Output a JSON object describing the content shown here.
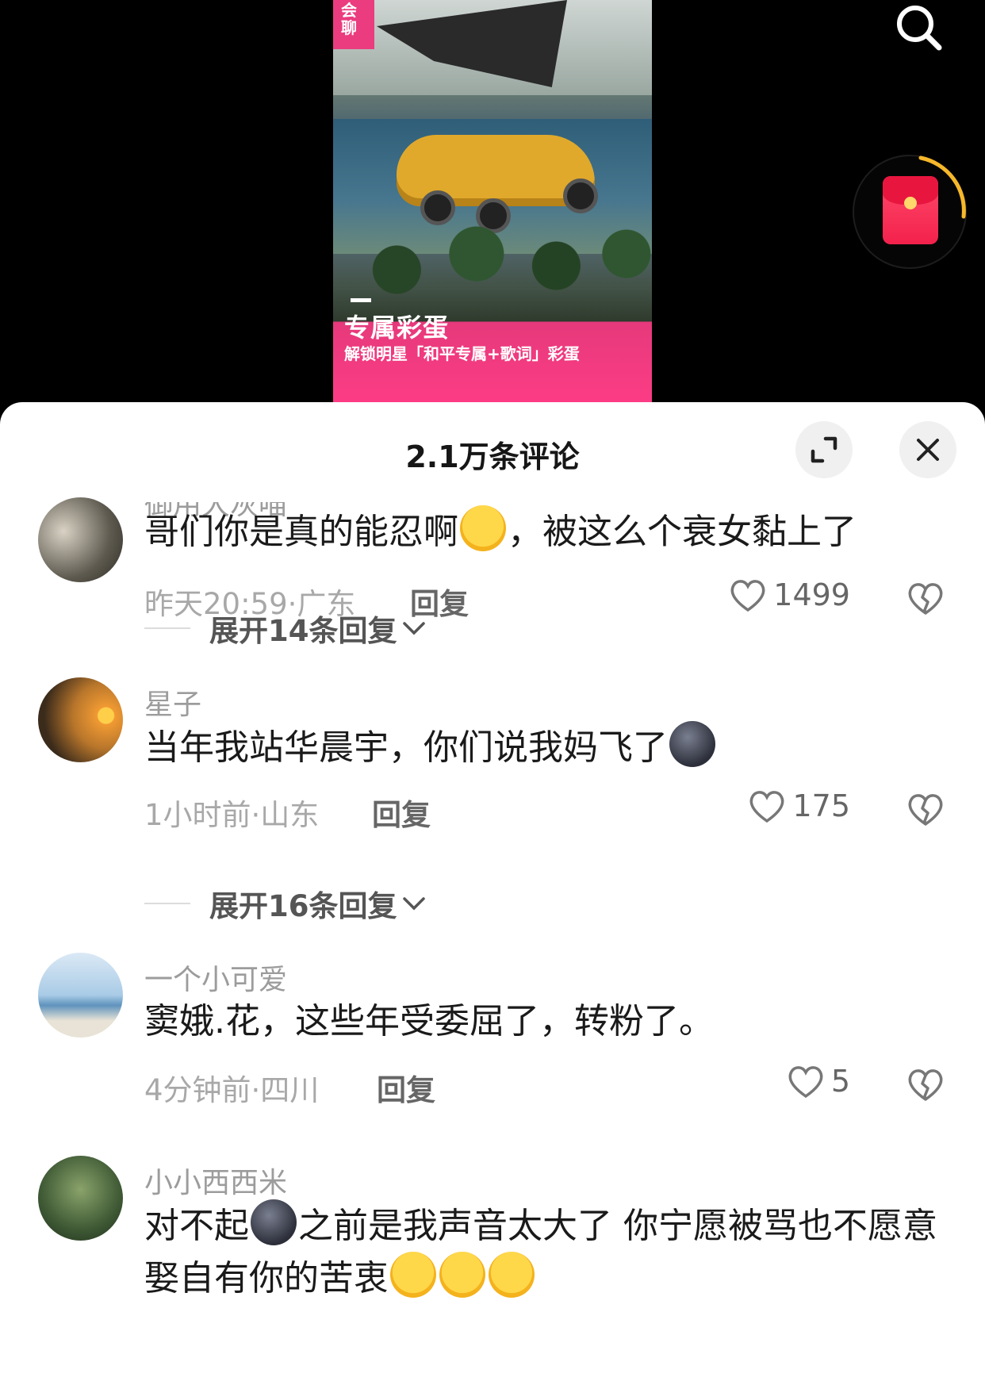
{
  "video": {
    "corner_badge": "会聊",
    "promo_title": "专属彩蛋",
    "promo_subtitle": "解锁明星「和平专属+歌词」彩蛋",
    "search_icon": "search-icon",
    "red_packet_icon": "red-packet-icon"
  },
  "sheet": {
    "title": "2.1万条评论",
    "expand_icon": "expand-icon",
    "close_icon": "close-icon"
  },
  "comments": [
    {
      "name": "御用大灰喵",
      "text_before": "哥们你是真的能忍啊",
      "text_after": "，被这么个衰女黏上了",
      "meta": "昨天20:59·广东",
      "reply": "回复",
      "likes": "1499",
      "expand": "展开14条回复"
    },
    {
      "name": "星子",
      "text_before": "当年我站华晨宇，你们说我妈飞了",
      "text_after": "",
      "meta": "1小时前·山东",
      "reply": "回复",
      "likes": "175",
      "expand": "展开16条回复"
    },
    {
      "name": "一个小可爱",
      "text_before": "窦娥.花，这些年受委屈了，转粉了。",
      "text_after": "",
      "meta": "4分钟前·四川",
      "reply": "回复",
      "likes": "5"
    },
    {
      "name": "小小西西米",
      "text_before": "对不起",
      "text_after": "之前是我声音太大了 你宁愿被骂也不愿意娶自有你的苦衷"
    }
  ],
  "colors": {
    "accent": "#ea3c7f",
    "red_packet": "#f3214c",
    "ring": "#f6b72a"
  }
}
